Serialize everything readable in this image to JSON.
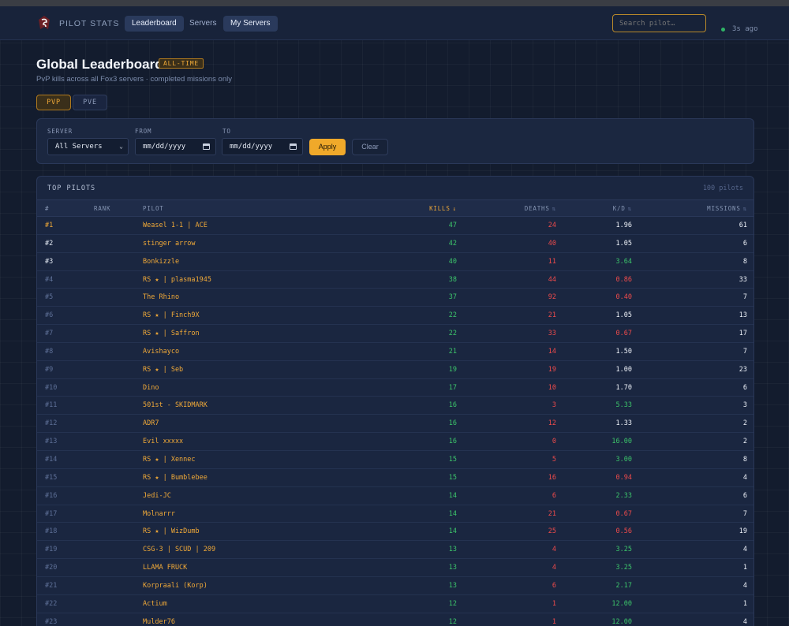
{
  "nav": {
    "brand": "PILOT STATS",
    "links": [
      "Leaderboard",
      "Servers",
      "My Servers"
    ],
    "search_placeholder": "Search pilot…",
    "status": "3s ago"
  },
  "header": {
    "title": "Global Leaderboard",
    "badge": "ALL-TIME",
    "subtitle": "PvP kills across all Fox3 servers · completed missions only"
  },
  "mode_tabs": [
    "PVP",
    "PVE"
  ],
  "filters": {
    "server_label": "SERVER",
    "server_value": "All Servers",
    "from_label": "FROM",
    "from_value": "mm/dd/yyyy",
    "to_label": "TO",
    "to_value": "mm/dd/yyyy",
    "apply_label": "Apply",
    "clear_label": "Clear"
  },
  "table": {
    "title": "TOP PILOTS",
    "count": "100 pilots",
    "columns": {
      "num": "#",
      "rank": "RANK",
      "pilot": "PILOT",
      "kills": "KILLS",
      "deaths": "DEATHS",
      "kd": "K/D",
      "missions": "MISSIONS"
    },
    "sort_active": "↓",
    "sort_inactive": "⇅",
    "rows": [
      {
        "rank": "#1",
        "pilot": "Weasel 1-1 | ACE",
        "kills": "47",
        "deaths": "24",
        "kd": "1.96",
        "missions": "61",
        "kd_color": "white"
      },
      {
        "rank": "#2",
        "pilot": "stinger arrow",
        "kills": "42",
        "deaths": "40",
        "kd": "1.05",
        "missions": "6",
        "kd_color": "white"
      },
      {
        "rank": "#3",
        "pilot": "Bonkizzle",
        "kills": "40",
        "deaths": "11",
        "kd": "3.64",
        "missions": "8",
        "kd_color": "green"
      },
      {
        "rank": "#4",
        "pilot": "RS ★ | plasma1945",
        "kills": "38",
        "deaths": "44",
        "kd": "0.86",
        "missions": "33",
        "kd_color": "red"
      },
      {
        "rank": "#5",
        "pilot": "The Rhino",
        "kills": "37",
        "deaths": "92",
        "kd": "0.40",
        "missions": "7",
        "kd_color": "red"
      },
      {
        "rank": "#6",
        "pilot": "RS ★ | Finch9X",
        "kills": "22",
        "deaths": "21",
        "kd": "1.05",
        "missions": "13",
        "kd_color": "white"
      },
      {
        "rank": "#7",
        "pilot": "RS ★ | Saffron",
        "kills": "22",
        "deaths": "33",
        "kd": "0.67",
        "missions": "17",
        "kd_color": "red"
      },
      {
        "rank": "#8",
        "pilot": "Avishayco",
        "kills": "21",
        "deaths": "14",
        "kd": "1.50",
        "missions": "7",
        "kd_color": "white"
      },
      {
        "rank": "#9",
        "pilot": "RS ★ | Seb",
        "kills": "19",
        "deaths": "19",
        "kd": "1.00",
        "missions": "23",
        "kd_color": "white"
      },
      {
        "rank": "#10",
        "pilot": "Dino",
        "kills": "17",
        "deaths": "10",
        "kd": "1.70",
        "missions": "6",
        "kd_color": "white"
      },
      {
        "rank": "#11",
        "pilot": "501st - SKIDMARK",
        "kills": "16",
        "deaths": "3",
        "kd": "5.33",
        "missions": "3",
        "kd_color": "green"
      },
      {
        "rank": "#12",
        "pilot": "ADR7",
        "kills": "16",
        "deaths": "12",
        "kd": "1.33",
        "missions": "2",
        "kd_color": "white"
      },
      {
        "rank": "#13",
        "pilot": "Evil xxxxx",
        "kills": "16",
        "deaths": "0",
        "kd": "16.00",
        "missions": "2",
        "kd_color": "green"
      },
      {
        "rank": "#14",
        "pilot": "RS ★ | Xennec",
        "kills": "15",
        "deaths": "5",
        "kd": "3.00",
        "missions": "8",
        "kd_color": "green"
      },
      {
        "rank": "#15",
        "pilot": "RS ★ | Bumblebee",
        "kills": "15",
        "deaths": "16",
        "kd": "0.94",
        "missions": "4",
        "kd_color": "red"
      },
      {
        "rank": "#16",
        "pilot": "Jedi-JC",
        "kills": "14",
        "deaths": "6",
        "kd": "2.33",
        "missions": "6",
        "kd_color": "green"
      },
      {
        "rank": "#17",
        "pilot": "Molnarrr",
        "kills": "14",
        "deaths": "21",
        "kd": "0.67",
        "missions": "7",
        "kd_color": "red"
      },
      {
        "rank": "#18",
        "pilot": "RS ★ | WizDumb",
        "kills": "14",
        "deaths": "25",
        "kd": "0.56",
        "missions": "19",
        "kd_color": "red"
      },
      {
        "rank": "#19",
        "pilot": "CSG-3 | SCUD | 209",
        "kills": "13",
        "deaths": "4",
        "kd": "3.25",
        "missions": "4",
        "kd_color": "green"
      },
      {
        "rank": "#20",
        "pilot": "LLAMA FRUCK",
        "kills": "13",
        "deaths": "4",
        "kd": "3.25",
        "missions": "1",
        "kd_color": "green"
      },
      {
        "rank": "#21",
        "pilot": "Korpraali (Korp)",
        "kills": "13",
        "deaths": "6",
        "kd": "2.17",
        "missions": "4",
        "kd_color": "green"
      },
      {
        "rank": "#22",
        "pilot": "Actium",
        "kills": "12",
        "deaths": "1",
        "kd": "12.00",
        "missions": "1",
        "kd_color": "green"
      },
      {
        "rank": "#23",
        "pilot": "Mulder76",
        "kills": "12",
        "deaths": "1",
        "kd": "12.00",
        "missions": "4",
        "kd_color": "green"
      }
    ]
  },
  "colors": {
    "accent": "#f0a938",
    "kills": "#3cc46a",
    "deaths": "#ef4b4b",
    "background": "#131c2e"
  }
}
